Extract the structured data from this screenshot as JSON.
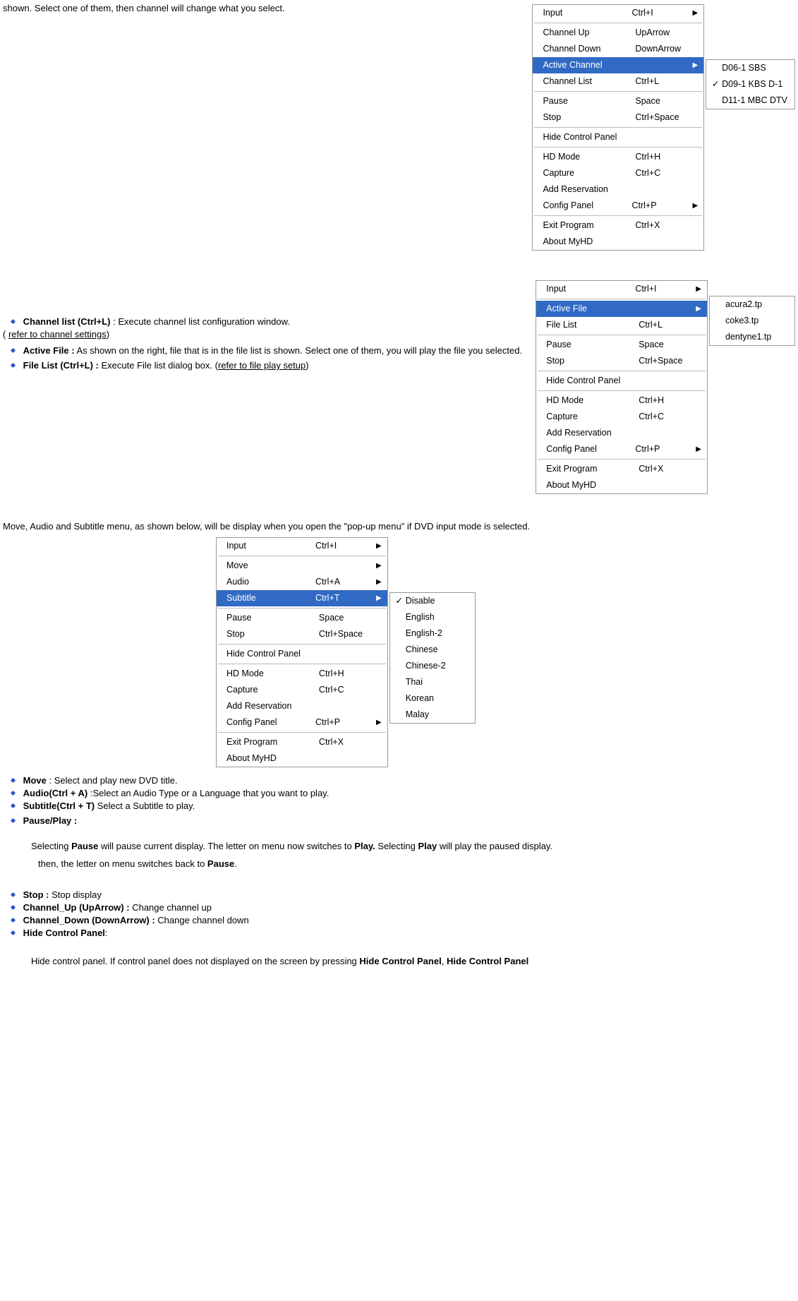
{
  "doc": {
    "intro_top": "shown. Select one of them, then channel will change what you select.",
    "channel_list_title": "Channel list (Ctrl+L)",
    "channel_list_desc": ": Execute channel list configuration window.",
    "channel_list_ref": "refer to channel settings",
    "active_file_title": "Active File :",
    "active_file_desc": "As shown on the right, file that is in the file list is shown. Select one of them, you will play the file you selected.",
    "file_list_title": "File List (Ctrl+L) :",
    "file_list_desc": "Execute File list dialog box. (",
    "file_list_ref": "refer to  file play setup",
    "dvd_intro": "Move, Audio and Subtitle menu, as shown below, will be display when you open the \"pop-up menu\"  if DVD input mode is selected.",
    "move_title": "Move",
    "move_desc": ": Select and play new DVD title.",
    "audio_title": "Audio(Ctrl + A)",
    "audio_desc": ":Select an Audio Type or  a Language that you want to play.",
    "subtitle_title": "Subtitle(Ctrl + T)",
    "subtitle_desc": "Select a Subtitle to play.",
    "pause_title": "Pause/Play :",
    "pause_p1a": "Selecting ",
    "pause_p1b": "Pause",
    "pause_p1c": " will pause current display. The letter on menu now switches to ",
    "pause_p1d": "Play.",
    "pause_p1e": " Selecting ",
    "pause_p1f": "Play",
    "pause_p1g": " will play the paused  display.",
    "pause_p2a": "then, the letter on menu switches back to ",
    "pause_p2b": "Pause",
    "pause_p2c": ".",
    "stop_title": "Stop :",
    "stop_desc": "Stop display",
    "chup_title": "Channel_Up (UpArrow) :",
    "chup_desc": "Change channel up",
    "chdn_title": "Channel_Down (DownArrow) :",
    "chdn_desc": "Change channel down",
    "hide_title": "Hide Control Panel",
    "hide_colon": ":",
    "hide_p_a": "Hide control panel. If control panel does not displayed on the screen by pressing ",
    "hide_p_b": "Hide Control Panel",
    "hide_p_c": ", ",
    "hide_p_d": "Hide Control Panel"
  },
  "menu1": {
    "items": [
      {
        "label": "Input",
        "accel": "Ctrl+I",
        "arrow": true
      },
      {
        "sep": true
      },
      {
        "label": "Channel Up",
        "accel": "UpArrow"
      },
      {
        "label": "Channel Down",
        "accel": "DownArrow"
      },
      {
        "label": "Active Channel",
        "accel": "",
        "arrow": true,
        "hl": true
      },
      {
        "label": "Channel List",
        "accel": "Ctrl+L"
      },
      {
        "sep": true
      },
      {
        "label": "Pause",
        "accel": "Space"
      },
      {
        "label": "Stop",
        "accel": "Ctrl+Space"
      },
      {
        "sep": true
      },
      {
        "label": "Hide Control Panel",
        "accel": ""
      },
      {
        "sep": true
      },
      {
        "label": "HD Mode",
        "accel": "Ctrl+H"
      },
      {
        "label": "Capture",
        "accel": "Ctrl+C"
      },
      {
        "label": "Add Reservation",
        "accel": ""
      },
      {
        "label": "Config Panel",
        "accel": "Ctrl+P",
        "arrow": true
      },
      {
        "sep": true
      },
      {
        "label": "Exit Program",
        "accel": "Ctrl+X"
      },
      {
        "label": "About MyHD",
        "accel": ""
      }
    ],
    "sub": [
      {
        "label": "D06-1   SBS"
      },
      {
        "label": "D09-1   KBS D-1",
        "chk": true
      },
      {
        "label": "D11-1   MBC DTV"
      }
    ]
  },
  "menu2": {
    "items": [
      {
        "label": "Input",
        "accel": "Ctrl+I",
        "arrow": true
      },
      {
        "sep": true
      },
      {
        "label": "Active File",
        "accel": "",
        "arrow": true,
        "hl": true
      },
      {
        "label": "File List",
        "accel": "Ctrl+L"
      },
      {
        "sep": true
      },
      {
        "label": "Pause",
        "accel": "Space"
      },
      {
        "label": "Stop",
        "accel": "Ctrl+Space"
      },
      {
        "sep": true
      },
      {
        "label": "Hide Control Panel",
        "accel": ""
      },
      {
        "sep": true
      },
      {
        "label": "HD Mode",
        "accel": "Ctrl+H"
      },
      {
        "label": "Capture",
        "accel": "Ctrl+C"
      },
      {
        "label": "Add Reservation",
        "accel": ""
      },
      {
        "label": "Config Panel",
        "accel": "Ctrl+P",
        "arrow": true
      },
      {
        "sep": true
      },
      {
        "label": "Exit Program",
        "accel": "Ctrl+X"
      },
      {
        "label": "About MyHD",
        "accel": ""
      }
    ],
    "sub": [
      {
        "label": "acura2.tp"
      },
      {
        "label": "coke3.tp"
      },
      {
        "label": "dentyne1.tp"
      }
    ]
  },
  "menu3": {
    "items": [
      {
        "label": "Input",
        "accel": "Ctrl+I",
        "arrow": true
      },
      {
        "sep": true
      },
      {
        "label": "Move",
        "accel": "",
        "arrow": true
      },
      {
        "label": "Audio",
        "accel": "Ctrl+A",
        "arrow": true
      },
      {
        "label": "Subtitle",
        "accel": "Ctrl+T",
        "arrow": true,
        "hl": true
      },
      {
        "sep": true
      },
      {
        "label": "Pause",
        "accel": "Space"
      },
      {
        "label": "Stop",
        "accel": "Ctrl+Space"
      },
      {
        "sep": true
      },
      {
        "label": "Hide Control Panel",
        "accel": ""
      },
      {
        "sep": true
      },
      {
        "label": "HD Mode",
        "accel": "Ctrl+H"
      },
      {
        "label": "Capture",
        "accel": "Ctrl+C"
      },
      {
        "label": "Add Reservation",
        "accel": ""
      },
      {
        "label": "Config Panel",
        "accel": "Ctrl+P",
        "arrow": true
      },
      {
        "sep": true
      },
      {
        "label": "Exit Program",
        "accel": "Ctrl+X"
      },
      {
        "label": "About MyHD",
        "accel": ""
      }
    ],
    "sub": [
      {
        "label": "Disable",
        "chk": true
      },
      {
        "sep": true
      },
      {
        "label": "English"
      },
      {
        "label": "English-2"
      },
      {
        "label": "Chinese"
      },
      {
        "label": "Chinese-2"
      },
      {
        "label": "Thai"
      },
      {
        "label": "Korean"
      },
      {
        "label": "Malay"
      }
    ]
  }
}
